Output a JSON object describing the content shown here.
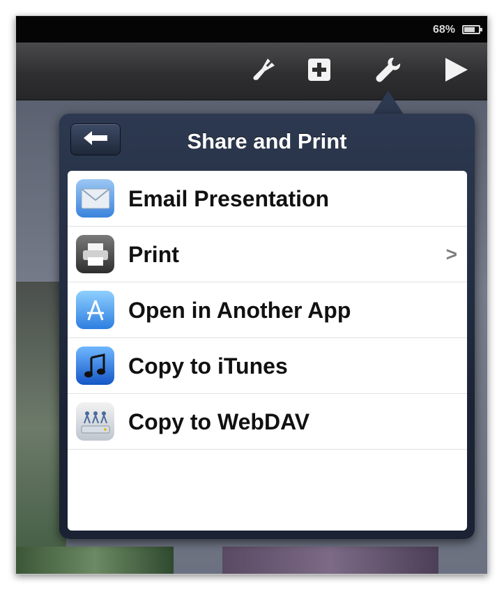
{
  "status_bar": {
    "battery_percent": "68%"
  },
  "toolbar": {
    "icons": [
      "paintbrush-icon",
      "insert-plus-icon",
      "wrench-icon",
      "play-icon"
    ]
  },
  "popover": {
    "title": "Share and Print",
    "back_icon": "back-arrow-icon",
    "items": [
      {
        "label": "Email Presentation",
        "icon": "mail-icon",
        "has_chevron": false
      },
      {
        "label": "Print",
        "icon": "printer-icon",
        "has_chevron": true,
        "chevron": ">"
      },
      {
        "label": "Open in Another App",
        "icon": "app-store-icon",
        "has_chevron": false
      },
      {
        "label": "Copy to iTunes",
        "icon": "music-note-icon",
        "has_chevron": false
      },
      {
        "label": "Copy to WebDAV",
        "icon": "network-drive-icon",
        "has_chevron": false
      }
    ]
  },
  "colors": {
    "toolbar": "#2f2f31",
    "popover_header": "#2d3950",
    "menu_background": "#ffffff",
    "label_text": "#111111"
  }
}
